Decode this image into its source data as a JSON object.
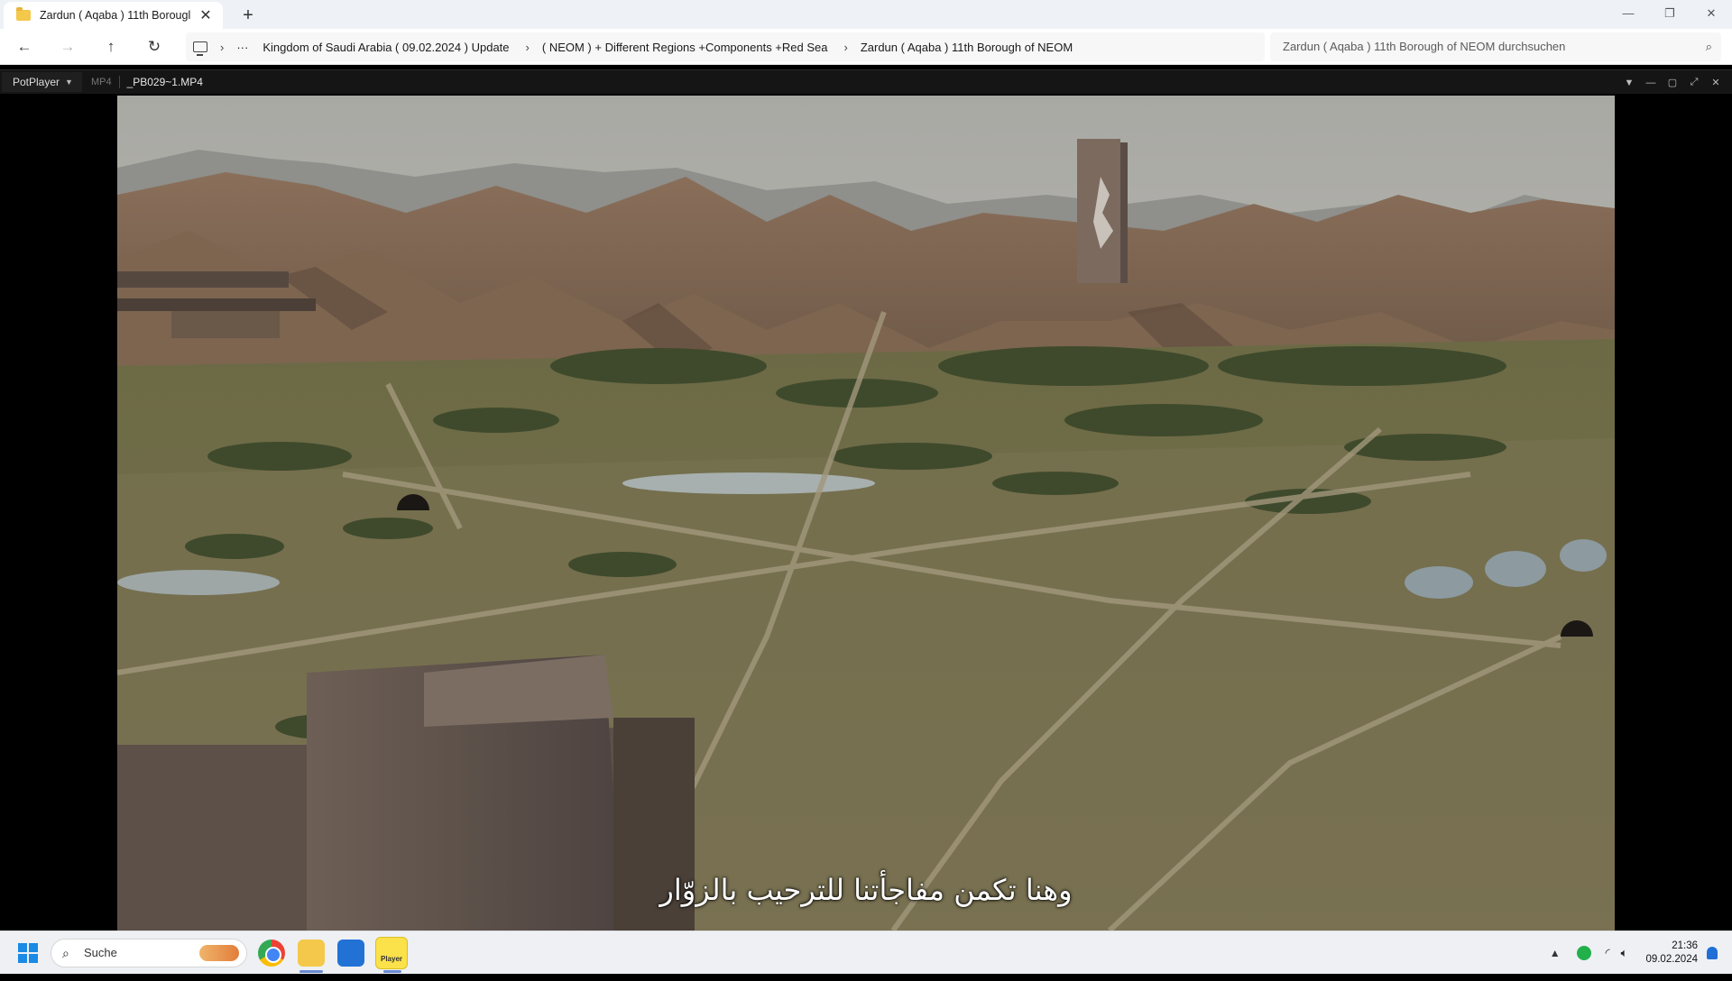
{
  "tab": {
    "title": "Zardun ( Aqaba ) 11th Borougl",
    "close": "✕",
    "new_tab": "+"
  },
  "window_controls": {
    "minimize": "—",
    "maximize": "❐",
    "close": "✕"
  },
  "nav": {
    "back": "←",
    "forward": "→",
    "up": "↑",
    "refresh": "↻"
  },
  "breadcrumb": {
    "overflow": "···",
    "segments": [
      "Kingdom of Saudi Arabia ( 09.02.2024 ) Update",
      "( NEOM ) + Different Regions +Components +Red Sea",
      "Zardun ( Aqaba ) 11th Borough of NEOM"
    ]
  },
  "search": {
    "placeholder": "Zardun ( Aqaba ) 11th Borough of NEOM durchsuchen"
  },
  "player": {
    "name": "PotPlayer",
    "format": "MP4",
    "filename": "_PB029~1.MP4",
    "subtitle": "وهنا تكمن مفاجأتنا للترحيب بالزوّار"
  },
  "taskbar": {
    "search_label": "Suche",
    "pot_label": "Player",
    "time": "21:36",
    "date": "09.02.2024"
  },
  "icons": [
    "folder-icon",
    "pc-icon",
    "search-icon",
    "windows-start-icon",
    "chrome-icon",
    "file-explorer-icon",
    "store-icon",
    "potplayer-icon",
    "wifi-icon",
    "volume-icon",
    "notification-bell-icon",
    "security-shield-icon"
  ],
  "colors": {
    "accent": "#1a8ae5",
    "tabstrip": "#eef1f6",
    "player_bar": "#151515",
    "taskbar": "#eef0f4"
  }
}
